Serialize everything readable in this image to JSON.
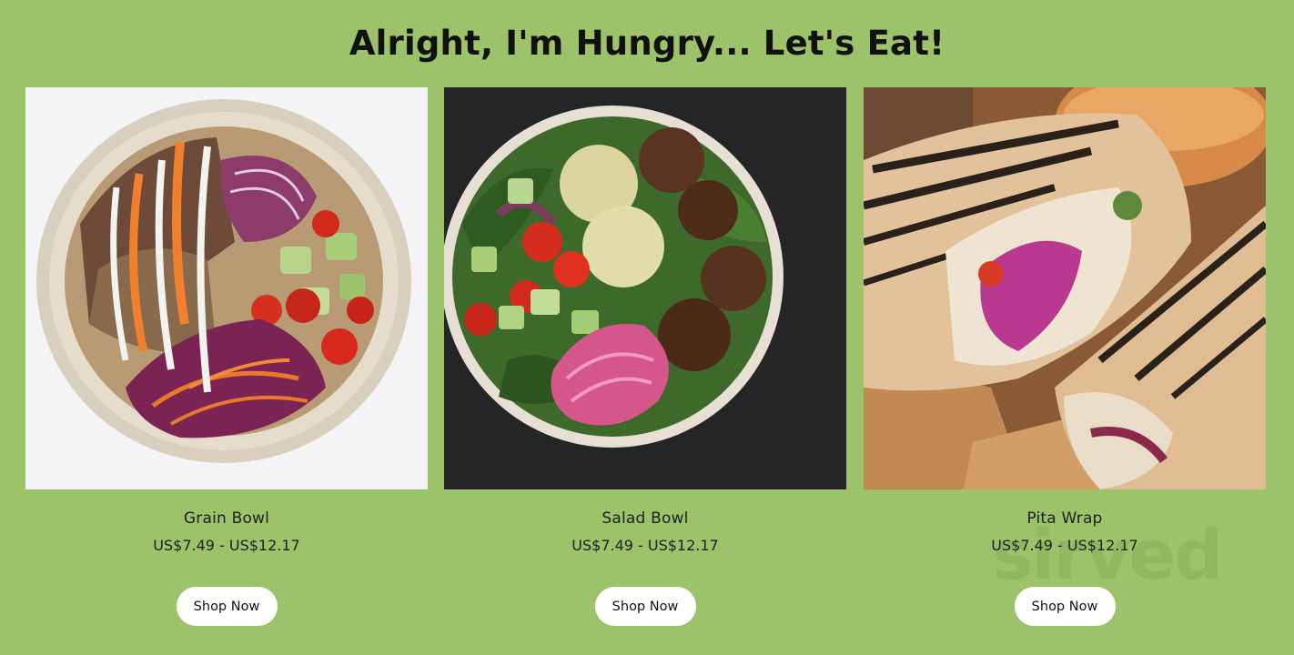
{
  "page": {
    "title": "Alright, I'm Hungry... Let's Eat!",
    "background": "#9dc36a",
    "watermark": "sirved"
  },
  "products": [
    {
      "name": "Grain Bowl",
      "price": "US$7.49 - US$12.17",
      "button_label": "Shop Now",
      "image_icon": "grain-bowl-photo"
    },
    {
      "name": "Salad Bowl",
      "price": "US$7.49 - US$12.17",
      "button_label": "Shop Now",
      "image_icon": "salad-bowl-photo"
    },
    {
      "name": "Pita Wrap",
      "price": "US$7.49 - US$12.17",
      "button_label": "Shop Now",
      "image_icon": "pita-wrap-photo"
    }
  ]
}
